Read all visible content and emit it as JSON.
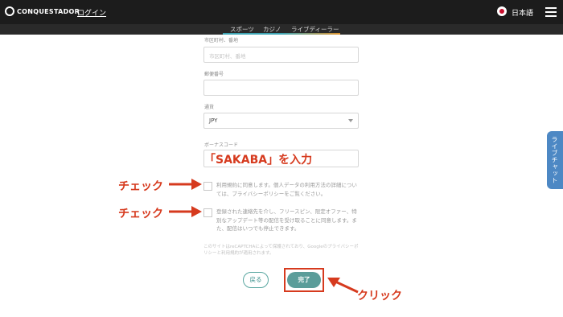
{
  "header": {
    "logo_text": "CONQUESTADOR",
    "login_label": "ログイン",
    "language_label": "日本語"
  },
  "tabs": [
    {
      "label": "スポーツ"
    },
    {
      "label": "カジノ"
    },
    {
      "label": "ライブディーラー"
    }
  ],
  "form": {
    "city_label": "市区町村、番地",
    "city_placeholder": "市区町村、番地",
    "postal_label": "郵便番号",
    "postal_value": "",
    "currency_label": "通貨",
    "currency_value": "JPY",
    "bonus_label": "ボーナスコード",
    "bonus_instruction": "「SAKABA」を入力",
    "terms_text": "利用規約に同意します。個人データの利用方法の詳細については、プライバシーポリシーをご覧ください。",
    "marketing_text": "登録された連絡先を介し、フリースピン、限定オファー、特別なアップデート等の配信を受け取ることに同意します。また、配信はいつでも停止できます。",
    "notice_text": "このサイトはreCAPTCHAによって保護されており、Googleのプライバシーポリシーと利用規約が適用されます。",
    "back_label": "戻る",
    "done_label": "完了"
  },
  "annotations": {
    "check1": "チェック",
    "check2": "チェック",
    "click": "クリック"
  },
  "live_chat_label": "ライブチャット",
  "colors": {
    "header_bg": "#1c1c1c",
    "accent_teal": "#5b9d9a",
    "annotation_red": "#d63a1e",
    "live_chat_blue": "#4d88c4"
  }
}
